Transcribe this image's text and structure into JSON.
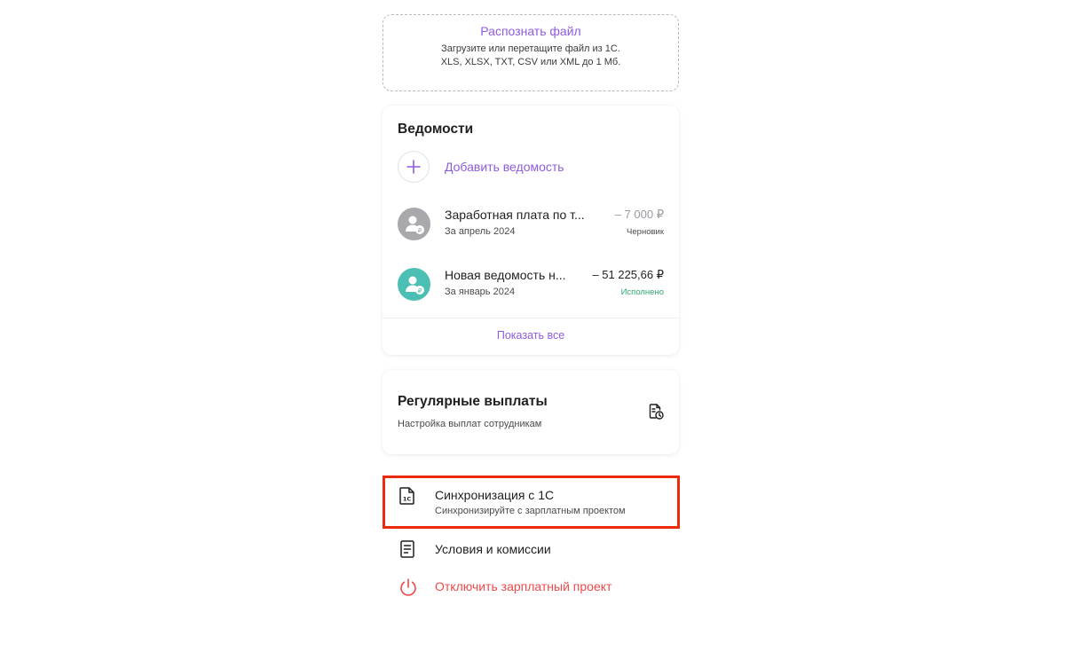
{
  "upload": {
    "title": "Распознать файл",
    "hint": "Загрузите или перетащите файл из 1С. XLS, XLSX, TXT, CSV или XML до 1 Мб."
  },
  "statements": {
    "title": "Ведомости",
    "add_label": "Добавить ведомость",
    "items": [
      {
        "name": "Заработная плата по т...",
        "period": "За апрель 2024",
        "amount": "– 7 000 ₽",
        "status": "Черновик",
        "avatar_color": "#a9a9ad",
        "amount_color": "#9a9aa0",
        "status_color": "#4a4a4a"
      },
      {
        "name": "Новая ведомость н...",
        "period": "За январь 2024",
        "amount": "– 51 225,66 ₽",
        "status": "Исполнено",
        "avatar_color": "#4bbfb3",
        "amount_color": "#1f1f1f",
        "status_color": "#2ea86e"
      }
    ],
    "show_all": "Показать все"
  },
  "regular": {
    "title": "Регулярные выплаты",
    "subtitle": "Настройка выплат сотрудникам"
  },
  "menu": {
    "sync_label": "Синхронизация с 1С",
    "sync_sub": "Синхронизируйте с зарплатным проектом",
    "terms_label": "Условия и комиссии",
    "disable_label": "Отключить зарплатный проект"
  },
  "colors": {
    "accent": "#8e5ce0",
    "danger": "#ef4a4a",
    "highlight": "#ee2a0c",
    "success": "#2ea86e"
  },
  "icons": {
    "plus": "plus-icon",
    "avatar": "employee-ruble-icon",
    "regular": "document-clock-icon",
    "sync": "file-1c-icon",
    "terms": "document-lines-icon",
    "disable": "power-icon"
  }
}
